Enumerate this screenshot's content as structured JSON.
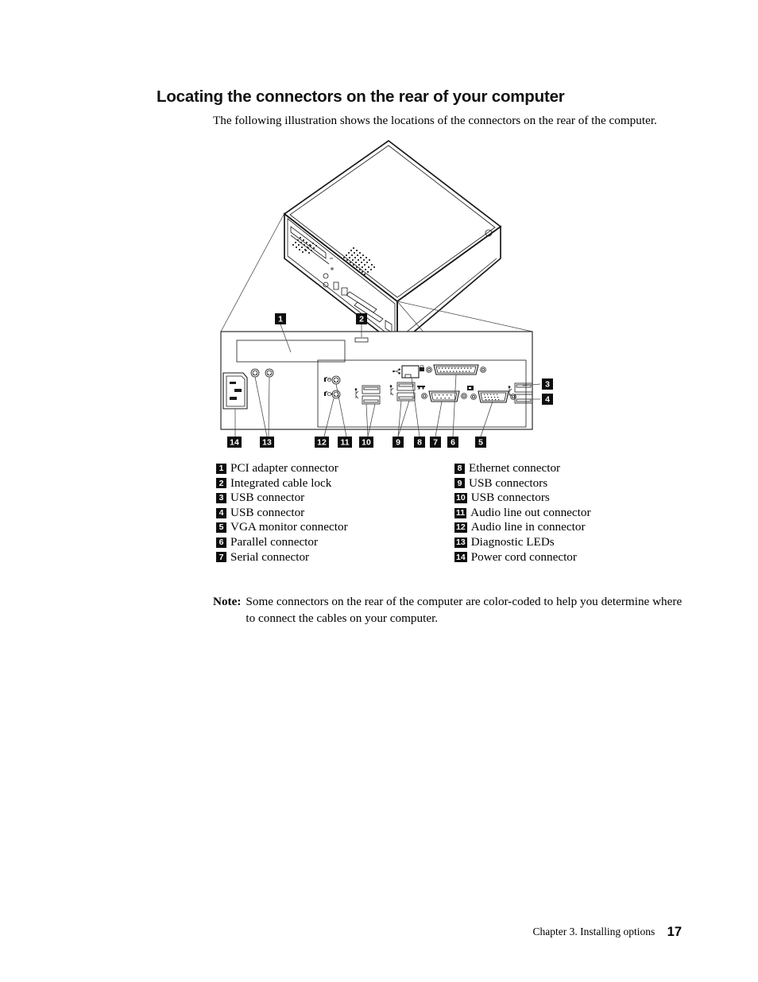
{
  "heading": "Locating the connectors on the rear of your computer",
  "intro": "The following illustration shows the locations of the connectors on the rear of the computer.",
  "figure": {
    "alt_description": "Isometric line drawing of a desktop computer chassis with an enlarged detail view of the rear panel connectors",
    "callouts": [
      "1",
      "2",
      "3",
      "4",
      "5",
      "6",
      "7",
      "8",
      "9",
      "10",
      "11",
      "12",
      "13",
      "14"
    ]
  },
  "legend": {
    "left_column": [
      {
        "num": "1",
        "label": "PCI adapter connector"
      },
      {
        "num": "2",
        "label": "Integrated cable lock"
      },
      {
        "num": "3",
        "label": "USB connector"
      },
      {
        "num": "4",
        "label": "USB connector"
      },
      {
        "num": "5",
        "label": "VGA monitor connector"
      },
      {
        "num": "6",
        "label": "Parallel connector"
      },
      {
        "num": "7",
        "label": "Serial connector"
      }
    ],
    "right_column": [
      {
        "num": "8",
        "label": "Ethernet connector"
      },
      {
        "num": "9",
        "label": "USB connectors"
      },
      {
        "num": "10",
        "label": "USB connectors"
      },
      {
        "num": "11",
        "label": "Audio line out connector"
      },
      {
        "num": "12",
        "label": "Audio line in connector"
      },
      {
        "num": "13",
        "label": "Diagnostic LEDs"
      },
      {
        "num": "14",
        "label": "Power cord connector"
      }
    ]
  },
  "note": {
    "label": "Note:",
    "text": "Some connectors on the rear of the computer are color-coded to help you determine where to connect the cables on your computer."
  },
  "footer": {
    "chapter": "Chapter 3. Installing options",
    "page": "17"
  }
}
